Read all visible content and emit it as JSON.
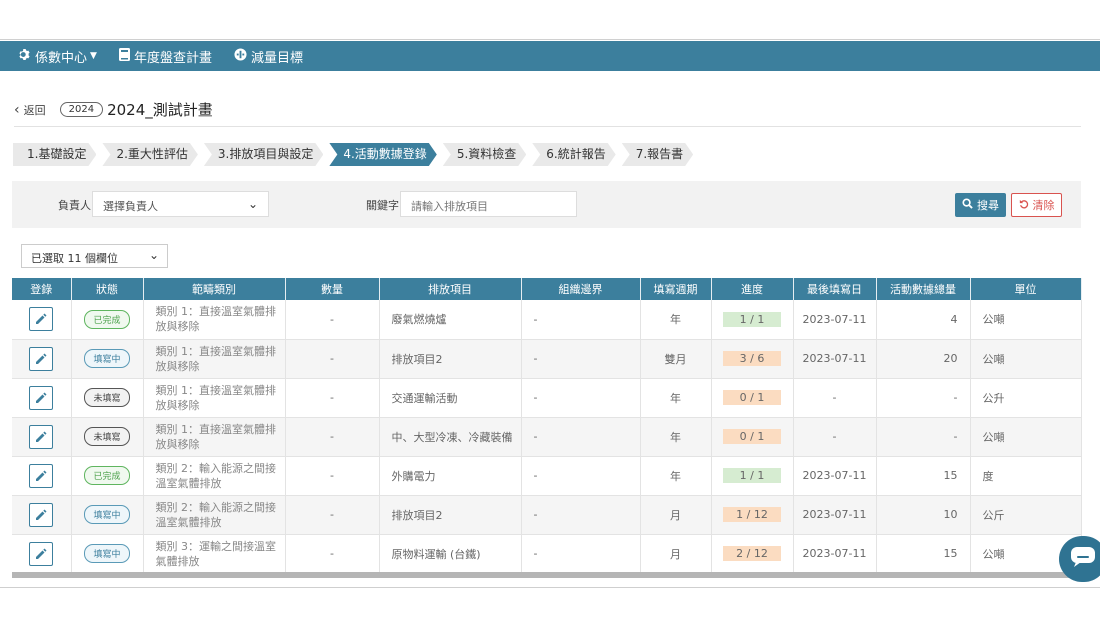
{
  "nav": {
    "items": [
      {
        "icon": "gear-icon",
        "label": "係數中心",
        "has_caret": true
      },
      {
        "icon": "book-icon",
        "label": "年度盤查計畫"
      },
      {
        "icon": "target-icon",
        "label": "減量目標"
      }
    ]
  },
  "header": {
    "back_label": "返回",
    "year": "2024",
    "title": "2024_測試計畫"
  },
  "steps": [
    "1.基礎設定",
    "2.重大性評估",
    "3.排放項目與設定",
    "4.活動數據登錄",
    "5.資料檢查",
    "6.統計報告",
    "7.報告書"
  ],
  "active_step": 3,
  "filter": {
    "owner_label": "負責人",
    "owner_placeholder": "選擇負責人",
    "keyword_label": "關鍵字",
    "keyword_placeholder": "請輸入排放項目",
    "search_label": "搜尋",
    "clear_label": "清除"
  },
  "column_selector": "已選取 11 個欄位",
  "table": {
    "headers": [
      "登錄",
      "狀態",
      "範疇類別",
      "數量",
      "排放項目",
      "組織邊界",
      "填寫週期",
      "進度",
      "最後填寫日",
      "活動數據總量",
      "單位"
    ],
    "rows": [
      {
        "status": "已完成",
        "status_type": "done",
        "category": "類別 1：直接溫室氣體排放與移除",
        "qty": "-",
        "item": "廢氣燃燒爐",
        "boundary": "-",
        "cycle": "年",
        "progress": "1 /  1",
        "progress_color": "green",
        "last_date": "2023-07-11",
        "total": "4",
        "unit": "公噸"
      },
      {
        "status": "填寫中",
        "status_type": "fill",
        "category": "類別 1：直接溫室氣體排放與移除",
        "qty": "-",
        "item": "排放項目2",
        "boundary": "-",
        "cycle": "雙月",
        "progress": "3 /  6",
        "progress_color": "orange",
        "last_date": "2023-07-11",
        "total": "20",
        "unit": "公噸"
      },
      {
        "status": "未填寫",
        "status_type": "none",
        "category": "類別 1：直接溫室氣體排放與移除",
        "qty": "-",
        "item": "交通運輸活動",
        "boundary": "-",
        "cycle": "年",
        "progress": "0 /  1",
        "progress_color": "orange",
        "last_date": "-",
        "total": "-",
        "unit": "公升"
      },
      {
        "status": "未填寫",
        "status_type": "none",
        "category": "類別 1：直接溫室氣體排放與移除",
        "qty": "-",
        "item": "中、大型冷凍、冷藏裝備",
        "boundary": "-",
        "cycle": "年",
        "progress": "0 /  1",
        "progress_color": "orange",
        "last_date": "-",
        "total": "-",
        "unit": "公噸"
      },
      {
        "status": "已完成",
        "status_type": "done",
        "category": "類別 2：輸入能源之間接溫室氣體排放",
        "qty": "-",
        "item": "外購電力",
        "boundary": "-",
        "cycle": "年",
        "progress": "1 /  1",
        "progress_color": "green",
        "last_date": "2023-07-11",
        "total": "15",
        "unit": "度"
      },
      {
        "status": "填寫中",
        "status_type": "fill",
        "category": "類別 2：輸入能源之間接溫室氣體排放",
        "qty": "-",
        "item": "排放項目2",
        "boundary": "-",
        "cycle": "月",
        "progress": "1 / 12",
        "progress_color": "orange",
        "last_date": "2023-07-11",
        "total": "10",
        "unit": "公斤"
      },
      {
        "status": "填寫中",
        "status_type": "fill",
        "category": "類別 3：運輸之間接溫室氣體排放",
        "qty": "-",
        "item": "原物料運輸 (台鐵)",
        "boundary": "-",
        "cycle": "月",
        "progress": "2 / 12",
        "progress_color": "orange",
        "last_date": "2023-07-11",
        "total": "15",
        "unit": "公噸"
      }
    ]
  }
}
